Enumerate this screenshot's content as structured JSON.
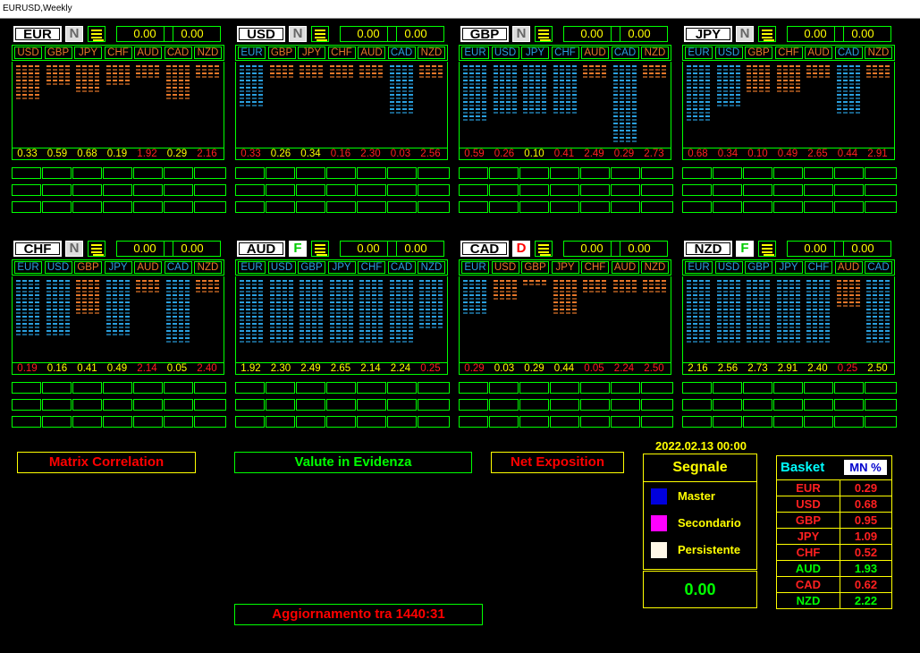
{
  "window": {
    "title": "EURUSD,Weekly"
  },
  "colors": {
    "green_frame": "#00ff00",
    "yellow": "#ffff00",
    "orange": "#e8782a",
    "blue": "#2aa0e0",
    "red": "#ff2020",
    "white": "#ffffff"
  },
  "panels": [
    {
      "currency": "EUR",
      "flag": "N",
      "value1": "0.00",
      "value2": "0.00",
      "tabs": [
        "USD",
        "GBP",
        "JPY",
        "CHF",
        "AUD",
        "CAD",
        "NZD"
      ],
      "tab_colors": [
        "orange",
        "orange",
        "orange",
        "orange",
        "orange",
        "orange",
        "orange"
      ],
      "bars": [
        {
          "c": "orange",
          "n": 5
        },
        {
          "c": "orange",
          "n": 3
        },
        {
          "c": "orange",
          "n": 4
        },
        {
          "c": "orange",
          "n": 3
        },
        {
          "c": "orange",
          "n": 2
        },
        {
          "c": "orange",
          "n": 5
        },
        {
          "c": "orange",
          "n": 2
        }
      ],
      "numbers": [
        "0.33",
        "0.59",
        "0.68",
        "0.19",
        "1.92",
        "0.29",
        "2.16"
      ],
      "number_colors": [
        "yellow",
        "yellow",
        "yellow",
        "yellow",
        "red",
        "yellow",
        "red"
      ]
    },
    {
      "currency": "USD",
      "flag": "N",
      "value1": "0.00",
      "value2": "0.00",
      "tabs": [
        "EUR",
        "GBP",
        "JPY",
        "CHF",
        "AUD",
        "CAD",
        "NZD"
      ],
      "tab_colors": [
        "blue",
        "orange",
        "orange",
        "orange",
        "orange",
        "blue",
        "orange"
      ],
      "bars": [
        {
          "c": "blue",
          "n": 6
        },
        {
          "c": "orange",
          "n": 2
        },
        {
          "c": "orange",
          "n": 2
        },
        {
          "c": "orange",
          "n": 2
        },
        {
          "c": "orange",
          "n": 2
        },
        {
          "c": "blue",
          "n": 7
        },
        {
          "c": "orange",
          "n": 2
        }
      ],
      "numbers": [
        "0.33",
        "0.26",
        "0.34",
        "0.16",
        "2.30",
        "0.03",
        "2.56"
      ],
      "number_colors": [
        "red",
        "yellow",
        "yellow",
        "red",
        "red",
        "red",
        "red"
      ]
    },
    {
      "currency": "GBP",
      "flag": "N",
      "value1": "0.00",
      "value2": "0.00",
      "tabs": [
        "EUR",
        "USD",
        "JPY",
        "CHF",
        "AUD",
        "CAD",
        "NZD"
      ],
      "tab_colors": [
        "blue",
        "blue",
        "blue",
        "blue",
        "orange",
        "blue",
        "orange"
      ],
      "bars": [
        {
          "c": "blue",
          "n": 8
        },
        {
          "c": "blue",
          "n": 7
        },
        {
          "c": "blue",
          "n": 7
        },
        {
          "c": "blue",
          "n": 7
        },
        {
          "c": "orange",
          "n": 2
        },
        {
          "c": "blue",
          "n": 11
        },
        {
          "c": "orange",
          "n": 2
        }
      ],
      "numbers": [
        "0.59",
        "0.26",
        "0.10",
        "0.41",
        "2.49",
        "0.29",
        "2.73"
      ],
      "number_colors": [
        "red",
        "red",
        "yellow",
        "red",
        "red",
        "red",
        "red"
      ]
    },
    {
      "currency": "JPY",
      "flag": "N",
      "value1": "0.00",
      "value2": "0.00",
      "tabs": [
        "EUR",
        "USD",
        "GBP",
        "CHF",
        "AUD",
        "CAD",
        "NZD"
      ],
      "tab_colors": [
        "blue",
        "blue",
        "orange",
        "orange",
        "orange",
        "blue",
        "orange"
      ],
      "bars": [
        {
          "c": "blue",
          "n": 8
        },
        {
          "c": "blue",
          "n": 6
        },
        {
          "c": "orange",
          "n": 4
        },
        {
          "c": "orange",
          "n": 4
        },
        {
          "c": "orange",
          "n": 2
        },
        {
          "c": "blue",
          "n": 7
        },
        {
          "c": "orange",
          "n": 2
        }
      ],
      "numbers": [
        "0.68",
        "0.34",
        "0.10",
        "0.49",
        "2.65",
        "0.44",
        "2.91"
      ],
      "number_colors": [
        "red",
        "red",
        "red",
        "red",
        "red",
        "red",
        "red"
      ]
    },
    {
      "currency": "CHF",
      "flag": "N",
      "value1": "0.00",
      "value2": "0.00",
      "tabs": [
        "EUR",
        "USD",
        "GBP",
        "JPY",
        "AUD",
        "CAD",
        "NZD"
      ],
      "tab_colors": [
        "blue",
        "blue",
        "orange",
        "blue",
        "orange",
        "blue",
        "orange"
      ],
      "bars": [
        {
          "c": "blue",
          "n": 8
        },
        {
          "c": "blue",
          "n": 8
        },
        {
          "c": "orange",
          "n": 5
        },
        {
          "c": "blue",
          "n": 8
        },
        {
          "c": "orange",
          "n": 2
        },
        {
          "c": "blue",
          "n": 9
        },
        {
          "c": "orange",
          "n": 2
        }
      ],
      "numbers": [
        "0.19",
        "0.16",
        "0.41",
        "0.49",
        "2.14",
        "0.05",
        "2.40"
      ],
      "number_colors": [
        "red",
        "yellow",
        "yellow",
        "yellow",
        "red",
        "yellow",
        "red"
      ]
    },
    {
      "currency": "AUD",
      "flag": "F",
      "value1": "0.00",
      "value2": "0.00",
      "tabs": [
        "EUR",
        "USD",
        "GBP",
        "JPY",
        "CHF",
        "CAD",
        "NZD"
      ],
      "tab_colors": [
        "blue",
        "blue",
        "blue",
        "blue",
        "blue",
        "blue",
        "blue"
      ],
      "bars": [
        {
          "c": "blue",
          "n": 9
        },
        {
          "c": "blue",
          "n": 9
        },
        {
          "c": "blue",
          "n": 9
        },
        {
          "c": "blue",
          "n": 9
        },
        {
          "c": "blue",
          "n": 9
        },
        {
          "c": "blue",
          "n": 9
        },
        {
          "c": "blue",
          "n": 7
        }
      ],
      "numbers": [
        "1.92",
        "2.30",
        "2.49",
        "2.65",
        "2.14",
        "2.24",
        "0.25"
      ],
      "number_colors": [
        "yellow",
        "yellow",
        "yellow",
        "yellow",
        "yellow",
        "yellow",
        "red"
      ]
    },
    {
      "currency": "CAD",
      "flag": "D",
      "value1": "0.00",
      "value2": "0.00",
      "tabs": [
        "EUR",
        "USD",
        "GBP",
        "JPY",
        "CHF",
        "AUD",
        "NZD"
      ],
      "tab_colors": [
        "blue",
        "orange",
        "orange",
        "orange",
        "orange",
        "orange",
        "orange"
      ],
      "bars": [
        {
          "c": "blue",
          "n": 5
        },
        {
          "c": "orange",
          "n": 3
        },
        {
          "c": "orange",
          "n": 1
        },
        {
          "c": "orange",
          "n": 5
        },
        {
          "c": "orange",
          "n": 2
        },
        {
          "c": "orange",
          "n": 2
        },
        {
          "c": "orange",
          "n": 2
        }
      ],
      "numbers": [
        "0.29",
        "0.03",
        "0.29",
        "0.44",
        "0.05",
        "2.24",
        "2.50"
      ],
      "number_colors": [
        "red",
        "yellow",
        "yellow",
        "yellow",
        "red",
        "red",
        "red"
      ]
    },
    {
      "currency": "NZD",
      "flag": "F",
      "value1": "0.00",
      "value2": "0.00",
      "tabs": [
        "EUR",
        "USD",
        "GBP",
        "JPY",
        "CHF",
        "AUD",
        "CAD"
      ],
      "tab_colors": [
        "blue",
        "blue",
        "blue",
        "blue",
        "blue",
        "orange",
        "blue"
      ],
      "bars": [
        {
          "c": "blue",
          "n": 9
        },
        {
          "c": "blue",
          "n": 9
        },
        {
          "c": "blue",
          "n": 9
        },
        {
          "c": "blue",
          "n": 9
        },
        {
          "c": "blue",
          "n": 9
        },
        {
          "c": "orange",
          "n": 4
        },
        {
          "c": "blue",
          "n": 9
        }
      ],
      "numbers": [
        "2.16",
        "2.56",
        "2.73",
        "2.91",
        "2.40",
        "0.25",
        "2.50"
      ],
      "number_colors": [
        "yellow",
        "yellow",
        "yellow",
        "yellow",
        "yellow",
        "red",
        "yellow"
      ]
    }
  ],
  "buttons": {
    "matrix": "Matrix Correlation",
    "valute": "Valute in Evidenza",
    "net": "Net Exposition",
    "update": "Aggiornamento tra  1440:31"
  },
  "signal": {
    "date": "2022.02.13 00:00",
    "title": "Segnale",
    "items": [
      {
        "label": "Master",
        "color": "#0000dd"
      },
      {
        "label": "Secondario",
        "color": "#ff00ff"
      },
      {
        "label": "Persistente",
        "color": "#fff8e8"
      }
    ],
    "value": "0.00"
  },
  "basket": {
    "title": "Basket",
    "mode": "MN %",
    "rows": [
      {
        "currency": "EUR",
        "value": "0.29",
        "value_color": "red",
        "cur_color": "red"
      },
      {
        "currency": "USD",
        "value": "0.68",
        "value_color": "red",
        "cur_color": "red"
      },
      {
        "currency": "GBP",
        "value": "0.95",
        "value_color": "red",
        "cur_color": "red"
      },
      {
        "currency": "JPY",
        "value": "1.09",
        "value_color": "red",
        "cur_color": "red"
      },
      {
        "currency": "CHF",
        "value": "0.52",
        "value_color": "red",
        "cur_color": "red"
      },
      {
        "currency": "AUD",
        "value": "1.93",
        "value_color": "green",
        "cur_color": "green"
      },
      {
        "currency": "CAD",
        "value": "0.62",
        "value_color": "red",
        "cur_color": "red"
      },
      {
        "currency": "NZD",
        "value": "2.22",
        "value_color": "green",
        "cur_color": "green"
      }
    ]
  }
}
